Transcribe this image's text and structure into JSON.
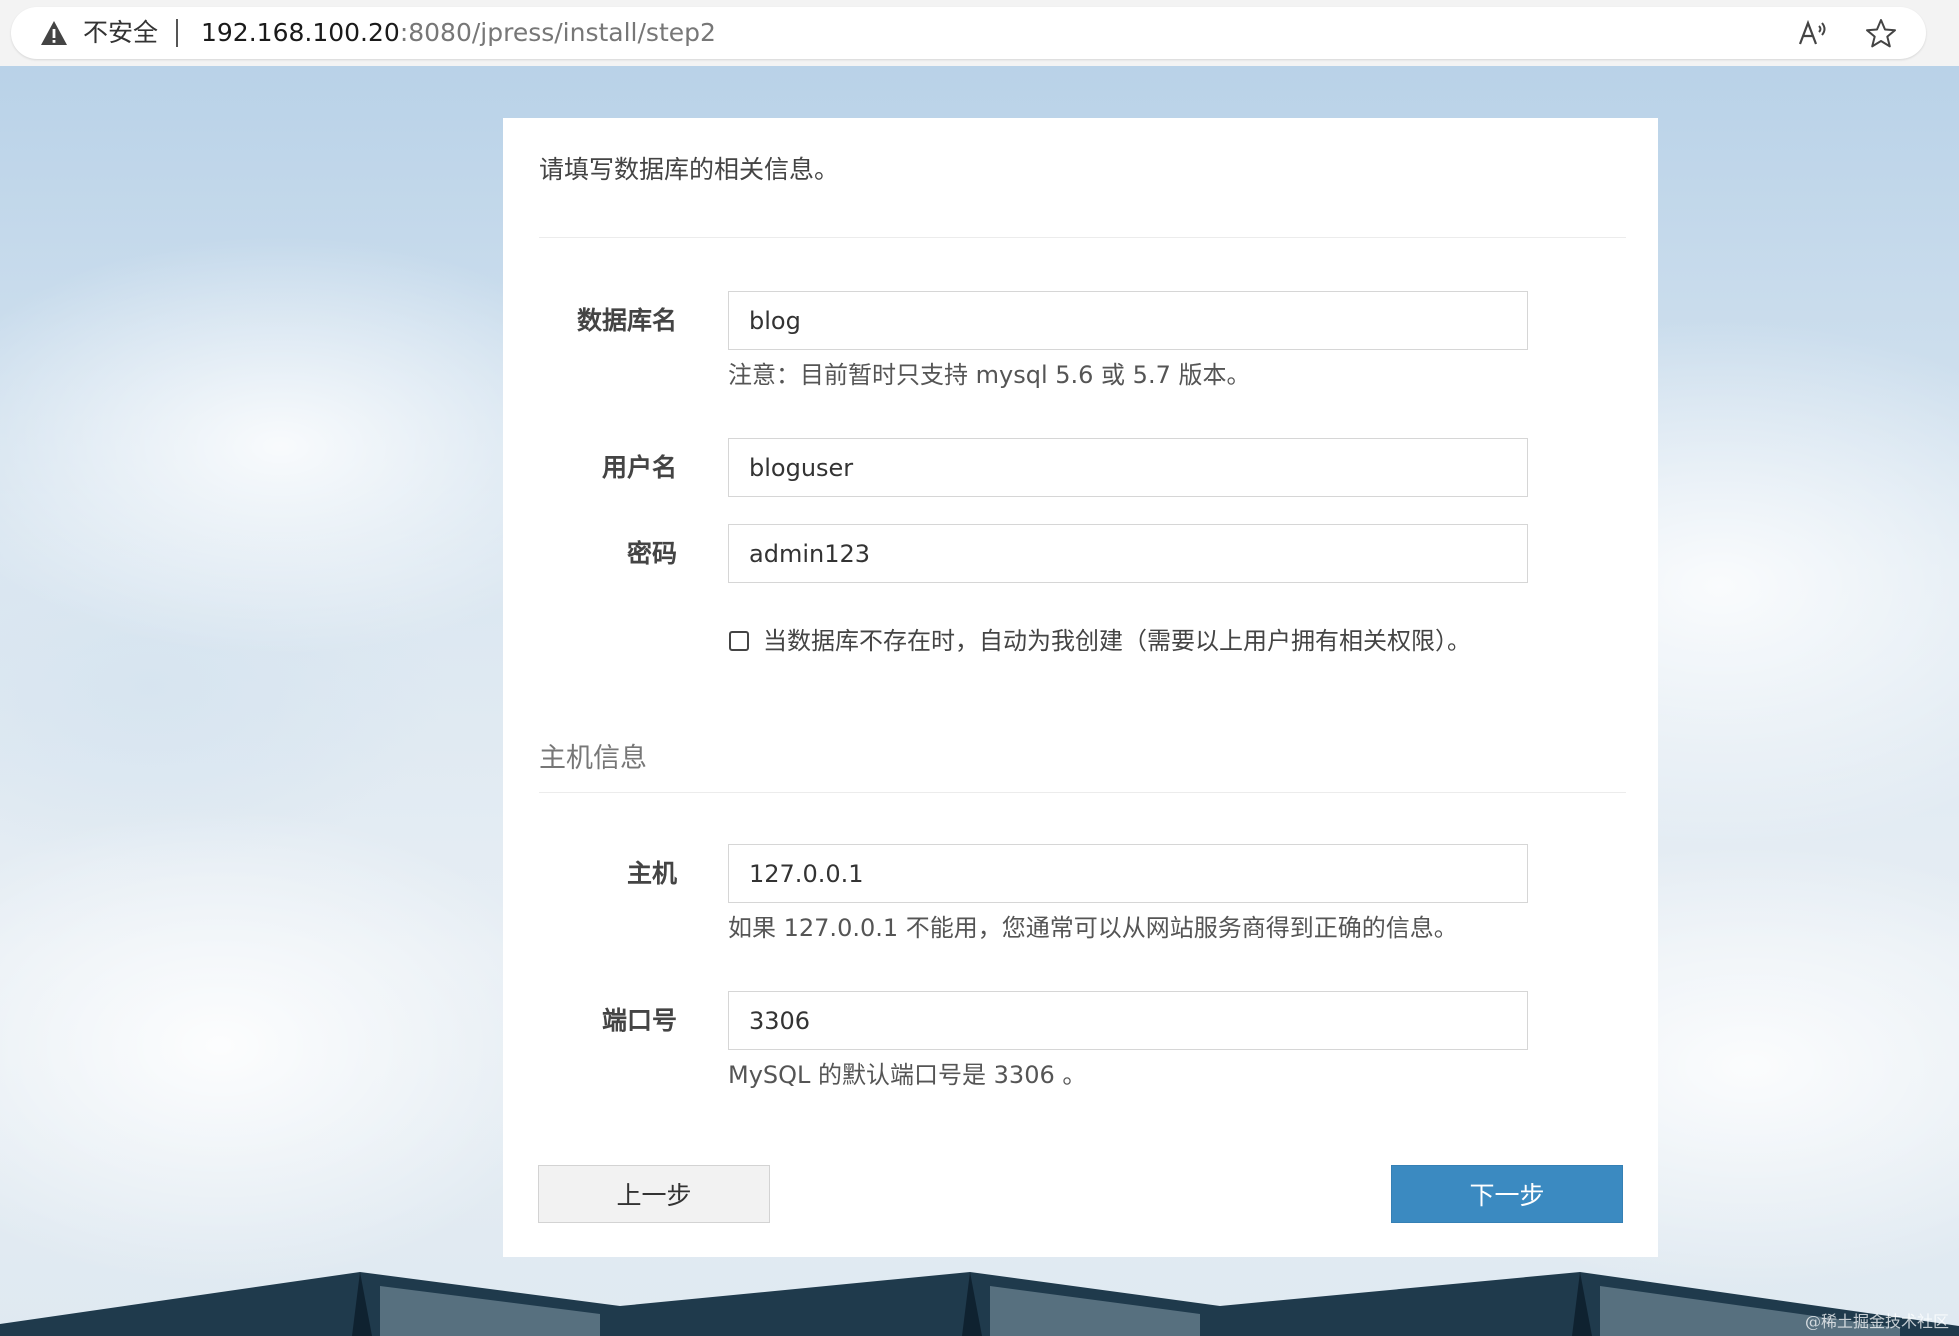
{
  "browser": {
    "security_label": "不安全",
    "url_host": "192.168.100.20",
    "url_rest": ":8080/jpress/install/step2",
    "icons": [
      "warning-icon",
      "read-aloud-icon",
      "favorite-star-icon"
    ]
  },
  "form": {
    "intro": "请填写数据库的相关信息。",
    "db_name": {
      "label": "数据库名",
      "value": "blog",
      "help": "注意：目前暂时只支持 mysql 5.6 或 5.7 版本。"
    },
    "username": {
      "label": "用户名",
      "value": "bloguser"
    },
    "password": {
      "label": "密码",
      "value": "admin123"
    },
    "create_db": {
      "checked": false,
      "label": "当数据库不存在时，自动为我创建（需要以上用户拥有相关权限）。"
    },
    "host_section_title": "主机信息",
    "host": {
      "label": "主机",
      "value": "127.0.0.1",
      "help": "如果 127.0.0.1 不能用，您通常可以从网站服务商得到正确的信息。"
    },
    "port": {
      "label": "端口号",
      "value": "3306",
      "help": "MySQL 的默认端口号是 3306 。"
    },
    "prev_button": "上一步",
    "next_button": "下一步"
  },
  "watermark": "@稀土掘金技术社区",
  "colors": {
    "primary_button": "#3b8ac1",
    "secondary_button": "#f2f2f2",
    "card_background": "#ffffff"
  }
}
